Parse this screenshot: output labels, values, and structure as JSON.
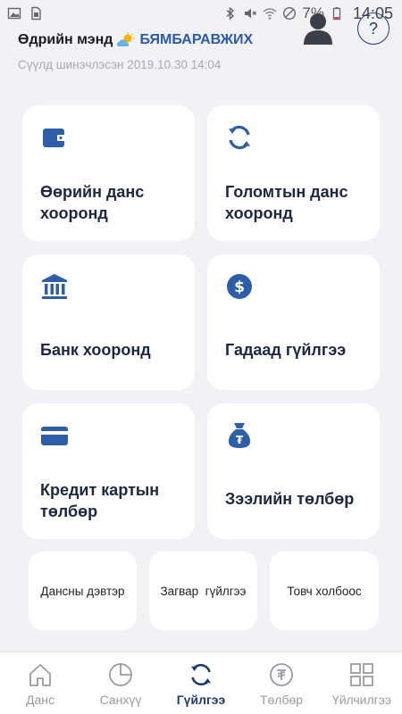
{
  "status_bar": {
    "battery": "7%",
    "time": "14:05"
  },
  "header": {
    "greeting": "Өдрийн мэнд",
    "username": "БЯМБАРАВЖИХ",
    "updated_text": "Сүүлд шинэчлэсэн 2019.10.30 14:04",
    "help_symbol": "?"
  },
  "tiles": [
    {
      "label_line1": "Өөрийн данс",
      "label_line2": "хооронд",
      "icon": "wallet-icon"
    },
    {
      "label_line1": "Голомтын данс",
      "label_line2": "хооронд",
      "icon": "sync-icon"
    },
    {
      "label_line1": "Банк хооронд",
      "icon": "bank-icon"
    },
    {
      "label_line1": "Гадаад гүйлгээ",
      "icon": "dollar-icon"
    },
    {
      "label_line1": "Кредит картын",
      "label_line2": "төлбөр",
      "icon": "credit-card-icon"
    },
    {
      "label_line1": "Зээлийн төлбөр",
      "icon": "money-bag-icon"
    }
  ],
  "small_tiles": [
    {
      "label": "Дансны дэвтэр"
    },
    {
      "label": "Загвар  гүйлгээ"
    },
    {
      "label": "Товч холбоос"
    }
  ],
  "nav": [
    {
      "label": "Данс",
      "icon": "home-icon"
    },
    {
      "label": "Санхүү",
      "icon": "pie-chart-icon"
    },
    {
      "label": "Гүйлгээ",
      "icon": "sync-icon",
      "active": true
    },
    {
      "label": "Төлбөр",
      "icon": "payment-icon"
    },
    {
      "label": "Үйлчилгээ",
      "icon": "grid-icon"
    }
  ],
  "colors": {
    "accent": "#2a5aa8",
    "icon_blue": "#2f5ea8",
    "background": "#f2f2f6",
    "inactive": "#9a9aa3"
  }
}
